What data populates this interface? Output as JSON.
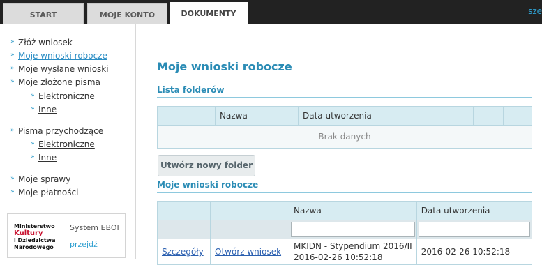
{
  "tabs": [
    {
      "label": "START"
    },
    {
      "label": "MOJE KONTO"
    },
    {
      "label": "DOKUMENTY"
    }
  ],
  "top_link": "sze",
  "sidebar": {
    "items": [
      {
        "label": "Złóż wniosek"
      },
      {
        "label": "Moje wnioski robocze"
      },
      {
        "label": "Moje wysłane wnioski"
      },
      {
        "label": "Moje złożone pisma"
      },
      {
        "label": "Elektroniczne"
      },
      {
        "label": "Inne"
      },
      {
        "label": "Pisma przychodzące"
      },
      {
        "label": "Elektroniczne"
      },
      {
        "label": "Inne"
      },
      {
        "label": "Moje sprawy"
      },
      {
        "label": "Moje płatności"
      }
    ],
    "eboi": {
      "logo_line1": "Ministerstwo",
      "logo_line2": "Kultury",
      "logo_line3": "i Dziedzictwa",
      "logo_line4": "Narodowego",
      "title": "System EBOI",
      "link": "przejdź"
    }
  },
  "main": {
    "page_title": "Moje wnioski robocze",
    "folders": {
      "title": "Lista folderów",
      "headers": [
        "",
        "Nazwa",
        "Data utworzenia",
        "",
        ""
      ],
      "empty_text": "Brak danych"
    },
    "new_folder_button": "Utwórz nowy folder",
    "drafts": {
      "title": "Moje wnioski robocze",
      "headers": [
        "",
        "",
        "Nazwa",
        "Data utworzenia"
      ],
      "rows": [
        {
          "details": "Szczegóły",
          "open": "Otwórz wniosek",
          "name_line1": "MKIDN - Stypendium 2016/II",
          "name_line2": "2016-02-26 10:52:18",
          "created": "2016-02-26 10:52:18"
        }
      ]
    }
  },
  "colors": {
    "topbar": "#222222",
    "accent": "#2b8cb5",
    "header_cell": "#d7ecf2",
    "logo_red": "#c8102e"
  }
}
